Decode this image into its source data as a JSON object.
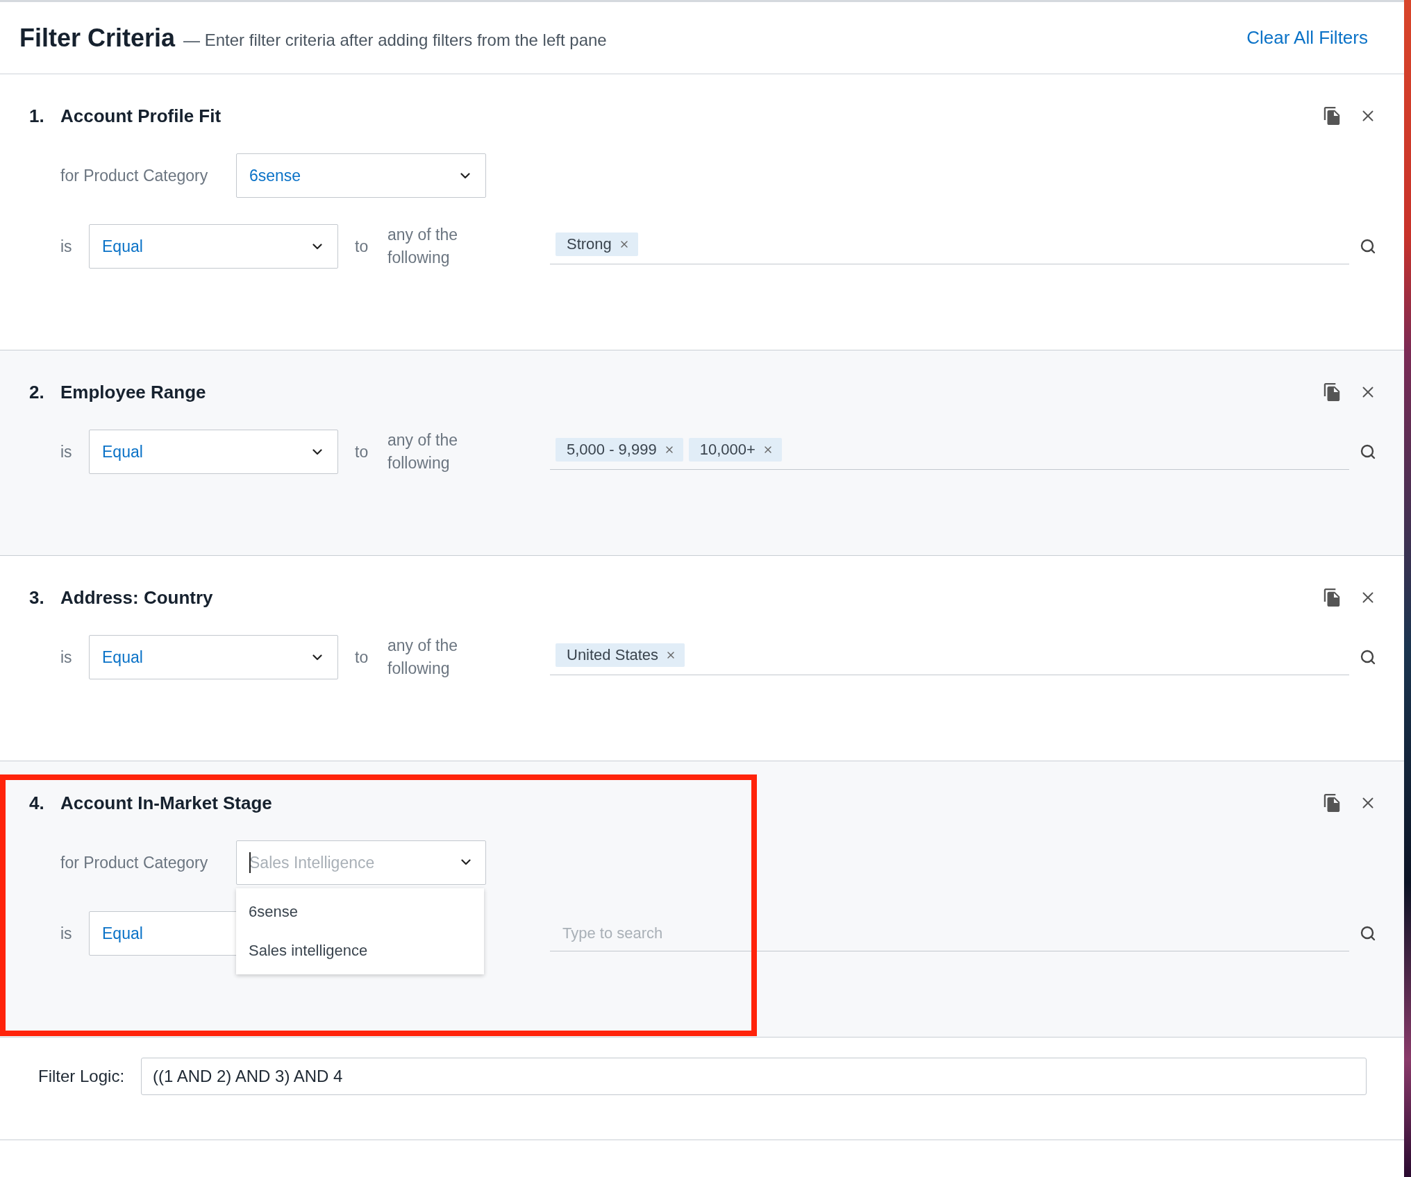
{
  "header": {
    "title": "Filter Criteria",
    "subtitle": "— Enter filter criteria after adding filters from the left pane",
    "clear_link": "Clear All Filters"
  },
  "filters": [
    {
      "number": "1.",
      "name": "Account Profile Fit",
      "highlighted": false,
      "product_category": {
        "label": "for Product Category",
        "value": "6sense",
        "focused": false,
        "expanded": false
      },
      "condition": {
        "label": "is",
        "operator": "Equal",
        "connector": "to",
        "qualifier": "any of the following"
      },
      "values": {
        "tags": [
          "Strong"
        ]
      }
    },
    {
      "number": "2.",
      "name": "Employee Range",
      "highlighted": false,
      "condition": {
        "label": "is",
        "operator": "Equal",
        "connector": "to",
        "qualifier": "any of the following"
      },
      "values": {
        "tags": [
          "5,000 - 9,999",
          "10,000+"
        ]
      }
    },
    {
      "number": "3.",
      "name": "Address: Country",
      "highlighted": false,
      "condition": {
        "label": "is",
        "operator": "Equal",
        "connector": "to",
        "qualifier": "any of the following"
      },
      "values": {
        "tags": [
          "United States"
        ]
      }
    },
    {
      "number": "4.",
      "name": "Account In-Market Stage",
      "highlighted": true,
      "product_category": {
        "label": "for Product Category",
        "placeholder": "Sales Intelligence",
        "focused": true,
        "expanded": true,
        "options": [
          "6sense",
          "Sales intelligence"
        ]
      },
      "condition": {
        "label": "is",
        "operator": "Equal"
      },
      "values": {
        "placeholder": "Type to search"
      }
    }
  ],
  "filter_logic": {
    "label": "Filter Logic:",
    "value": "((1 AND 2) AND 3) AND 4"
  }
}
